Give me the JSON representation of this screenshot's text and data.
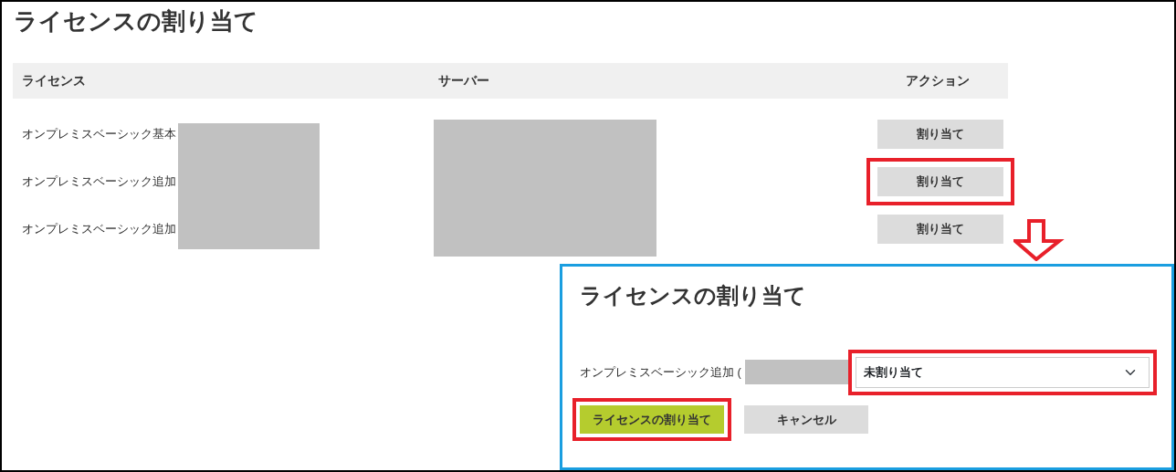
{
  "page": {
    "title": "ライセンスの割り当て"
  },
  "table": {
    "columns": [
      "ライセンス",
      "サーバー",
      "アクション"
    ],
    "rows": [
      {
        "license": "オンプレミスベーシック基本",
        "action": "割り当て",
        "highlighted": false
      },
      {
        "license": "オンプレミスベーシック追加",
        "action": "割り当て",
        "highlighted": true
      },
      {
        "license": "オンプレミスベーシック追加",
        "action": "割り当て",
        "highlighted": false
      }
    ]
  },
  "dialog": {
    "title": "ライセンスの割り当て",
    "label": "オンプレミスベーシック追加 (",
    "select": {
      "value": "未割り当て",
      "highlighted": true
    },
    "buttons": [
      {
        "kind": "primary",
        "label": "ライセンスの割り当て",
        "highlighted": true
      },
      {
        "kind": "secondary",
        "label": "キャンセル",
        "highlighted": false
      }
    ]
  }
}
